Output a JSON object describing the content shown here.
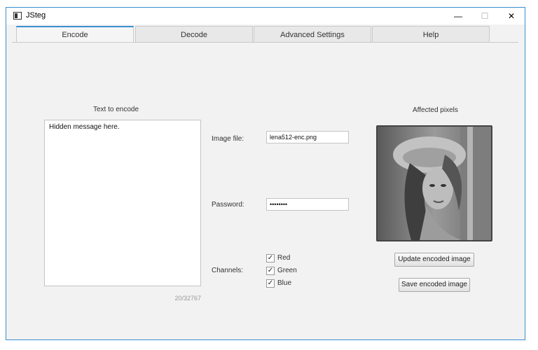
{
  "window": {
    "title": "JSteg",
    "minimize_glyph": "—",
    "maximize_glyph": "☐",
    "close_glyph": "✕"
  },
  "tabs": [
    {
      "label": "Encode",
      "active": true
    },
    {
      "label": "Decode",
      "active": false
    },
    {
      "label": "Advanced Settings",
      "active": false
    },
    {
      "label": "Help",
      "active": false
    }
  ],
  "encode": {
    "text_label": "Text to encode",
    "text_value": "Hidden message here.",
    "char_counter": "20/32767",
    "image_file_label": "Image file:",
    "image_file_value": "lena512-enc.png",
    "password_label": "Password:",
    "password_value": "secretpw",
    "channels_label": "Channels:",
    "channels": [
      {
        "label": "Red",
        "checked": true
      },
      {
        "label": "Green",
        "checked": true
      },
      {
        "label": "Blue",
        "checked": true
      }
    ],
    "affected_pixels_label": "Affected pixels",
    "update_button": "Update encoded image",
    "save_button": "Save encoded image"
  },
  "colors": {
    "accent": "#3a8fd0",
    "background": "#f2f2f2"
  },
  "check_glyph": "✓"
}
